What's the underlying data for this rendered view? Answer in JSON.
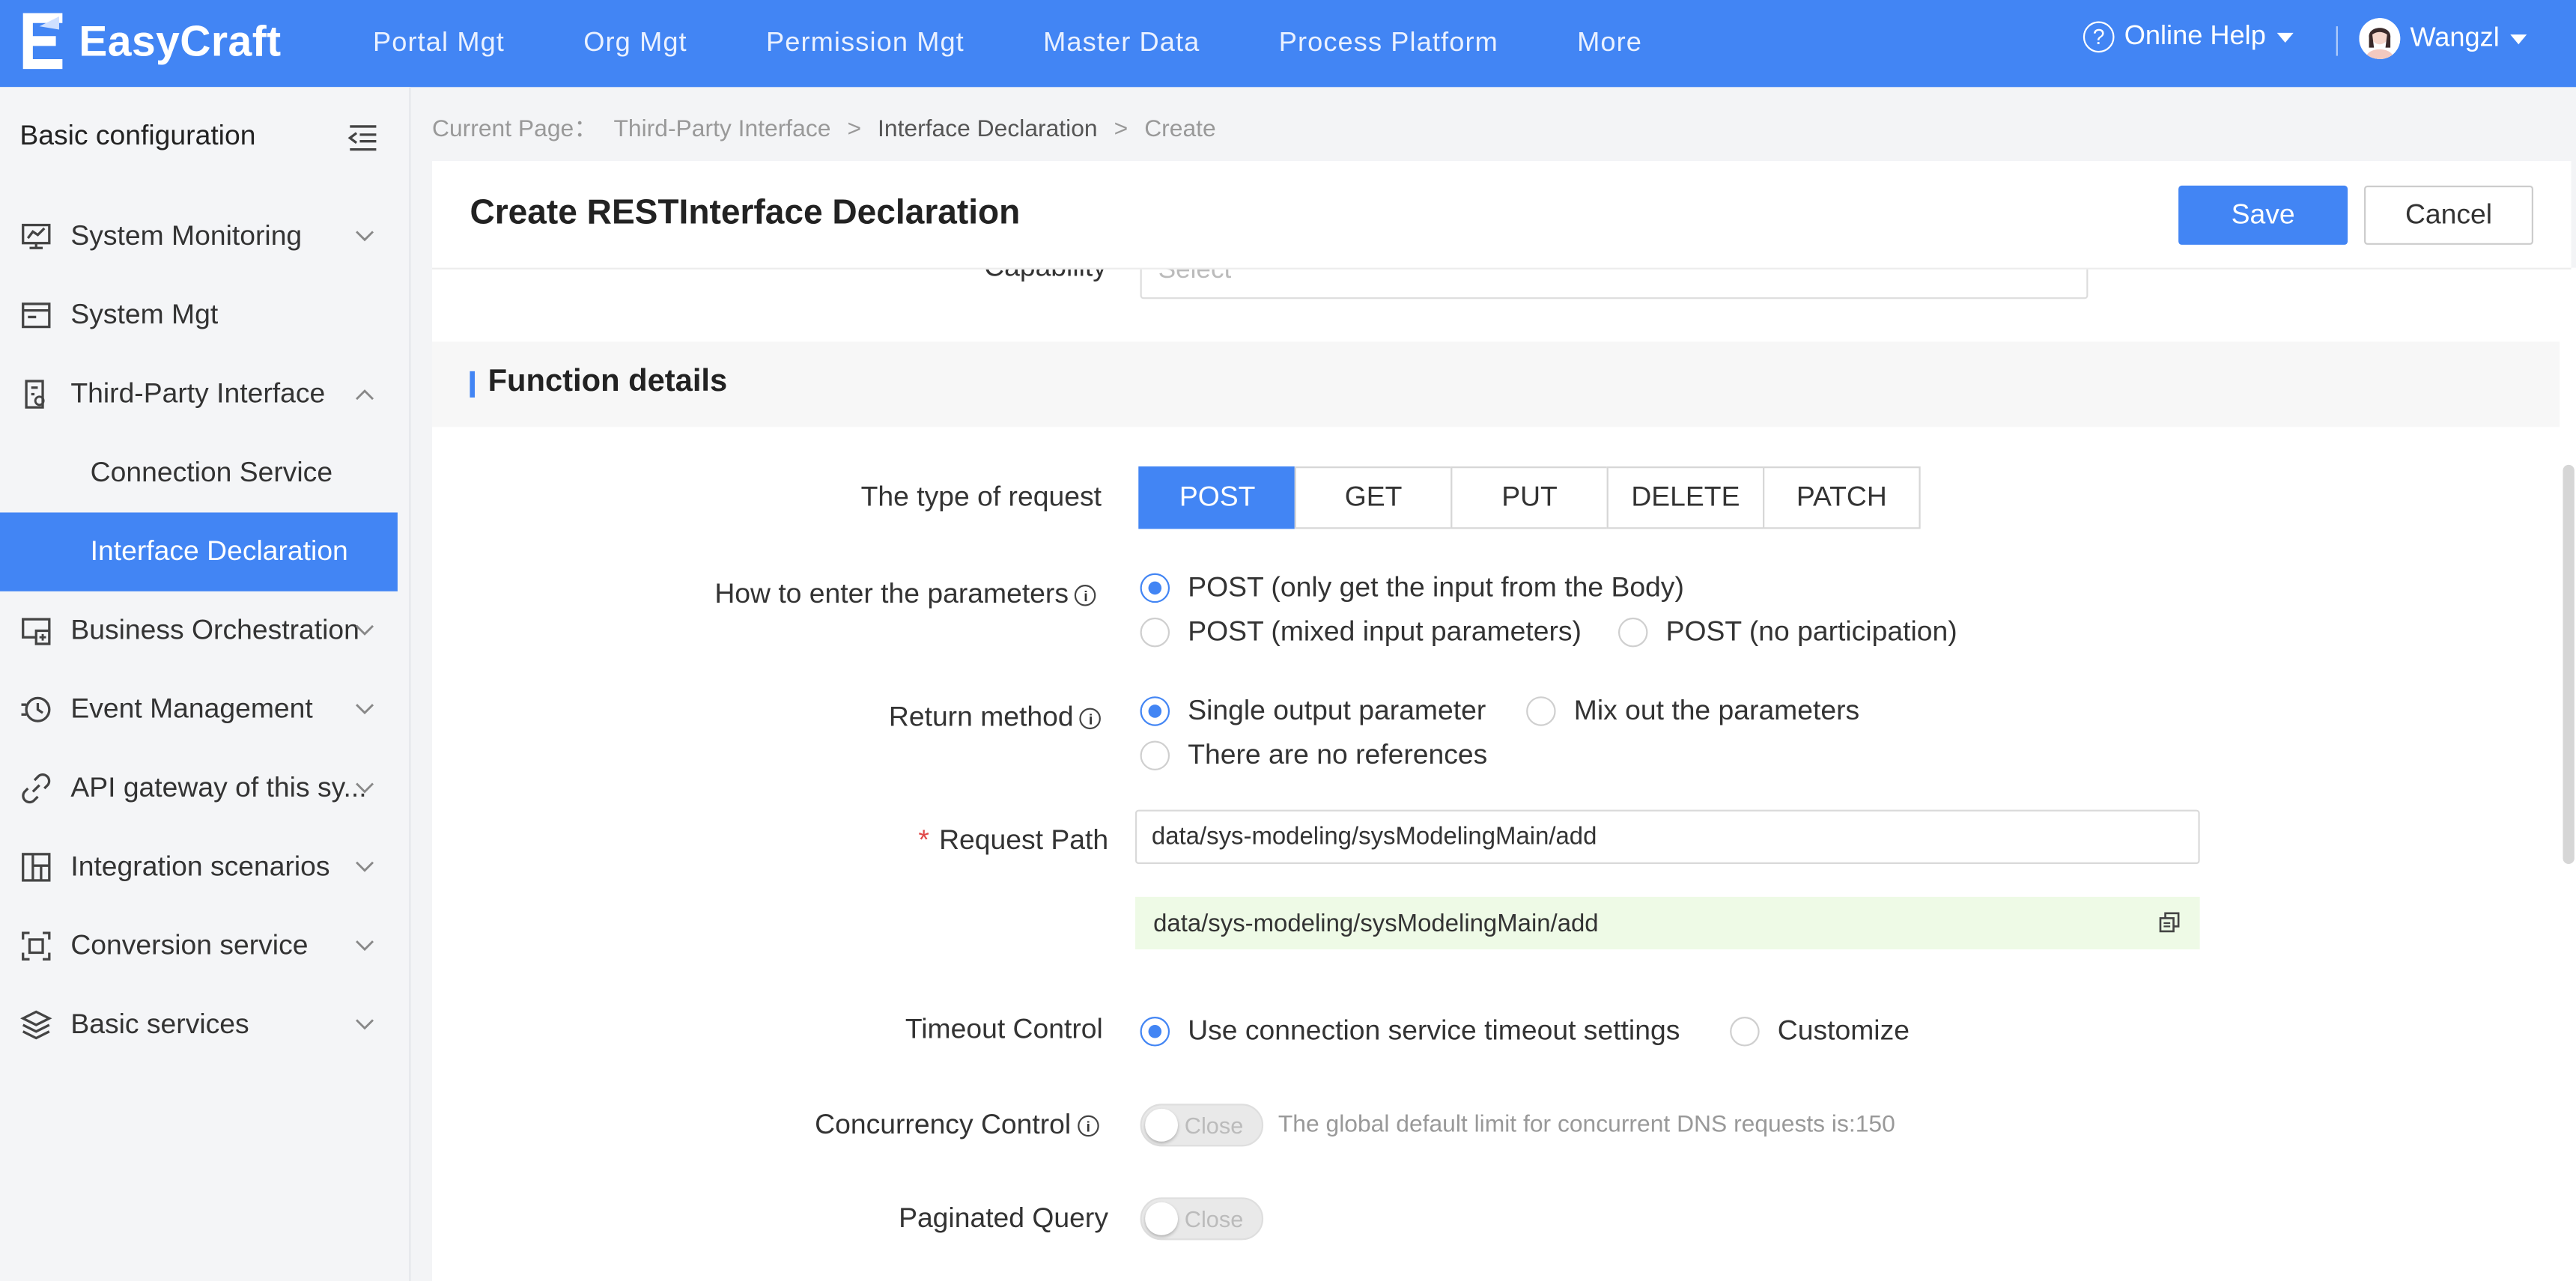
{
  "app": {
    "logo": "EasyCraft"
  },
  "topnav": {
    "items": [
      "Portal Mgt",
      "Org Mgt",
      "Permission Mgt",
      "Master Data",
      "Process Platform",
      "More"
    ]
  },
  "help": {
    "label": "Online Help"
  },
  "user": {
    "name": "Wangzl"
  },
  "sidebar": {
    "header": "Basic configuration",
    "items": [
      {
        "label": "System Monitoring",
        "icon": "monitor-chart-icon",
        "expandable": true
      },
      {
        "label": "System Mgt",
        "icon": "window-icon",
        "expandable": false
      },
      {
        "label": "Third-Party Interface",
        "icon": "document-link-icon",
        "expandable": true,
        "expanded": true
      },
      {
        "label": "Business Orchestration",
        "icon": "orchestration-icon",
        "expandable": true
      },
      {
        "label": "Event Management",
        "icon": "event-clock-icon",
        "expandable": true
      },
      {
        "label": "API gateway of this sy...",
        "icon": "link-icon",
        "expandable": true
      },
      {
        "label": "Integration scenarios",
        "icon": "layout-icon",
        "expandable": true
      },
      {
        "label": "Conversion service",
        "icon": "scan-frame-icon",
        "expandable": true
      },
      {
        "label": "Basic services",
        "icon": "layers-icon",
        "expandable": true
      }
    ],
    "subitems": [
      "Connection Service",
      "Interface Declaration"
    ],
    "active_subitem": "Interface Declaration"
  },
  "breadcrumb": {
    "prefix": "Current Page：",
    "items": [
      "Third-Party Interface",
      "Interface Declaration",
      "Create"
    ],
    "separator": ">"
  },
  "page": {
    "title": "Create RESTInterface Declaration",
    "save_label": "Save",
    "cancel_label": "Cancel"
  },
  "form": {
    "capability_label": "Capability",
    "capability_placeholder": "Select",
    "section_title": "Function details",
    "request_type": {
      "label": "The type of request",
      "options": [
        "POST",
        "GET",
        "PUT",
        "DELETE",
        "PATCH"
      ],
      "selected": "POST"
    },
    "param_entry": {
      "label": "How to enter the parameters",
      "options": [
        "POST (only get the input from the Body)",
        "POST (mixed input parameters)",
        "POST (no participation)"
      ],
      "selected": "POST (only get the input from the Body)"
    },
    "return_method": {
      "label": "Return method",
      "options": [
        "Single output parameter",
        "Mix out the parameters",
        "There are no references"
      ],
      "selected": "Single output parameter"
    },
    "request_path": {
      "label": "Request Path",
      "required_mark": "*",
      "value": "data/sys-modeling/sysModelingMain/add",
      "preview": "data/sys-modeling/sysModelingMain/add"
    },
    "timeout": {
      "label": "Timeout Control",
      "options": [
        "Use connection service timeout settings",
        "Customize"
      ],
      "selected": "Use connection service timeout settings"
    },
    "concurrency": {
      "label": "Concurrency Control",
      "switch_text": "Close",
      "hint": "The global default limit for concurrent DNS requests is:150"
    },
    "paginated": {
      "label": "Paginated Query",
      "switch_text": "Close"
    }
  },
  "colors": {
    "primary": "#4285f4",
    "preview_bg": "#eefae6",
    "required": "#e04848"
  }
}
